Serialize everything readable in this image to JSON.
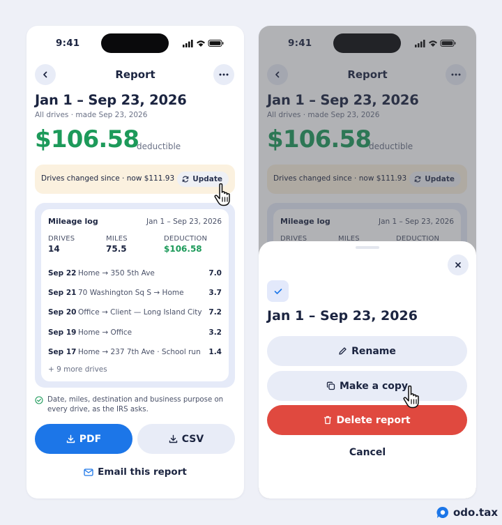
{
  "status": {
    "time": "9:41"
  },
  "screen": {
    "title": "Report",
    "period": "Jan 1 – Sep 23, 2026",
    "subtitle": "All drives · made Sep 23, 2026",
    "amount": "$106.58",
    "amount_suffix": "deductible",
    "banner_text": "Drives changed since · now $111.93",
    "update_label": "Update"
  },
  "log": {
    "title": "Mileage log",
    "date_range": "Jan 1 – Sep 23, 2026",
    "stats": [
      {
        "label": "DRIVES",
        "value": "14"
      },
      {
        "label": "MILES",
        "value": "75.5"
      },
      {
        "label": "DEDUCTION",
        "value": "$106.58"
      }
    ],
    "rows": [
      {
        "date": "Sep 22",
        "route": "Home → 350 5th Ave",
        "miles": "7.0"
      },
      {
        "date": "Sep 21",
        "route": "70 Washington Sq S → Home",
        "miles": "3.7"
      },
      {
        "date": "Sep 20",
        "route": "Office → Client — Long Island City",
        "miles": "7.2"
      },
      {
        "date": "Sep 19",
        "route": "Home → Office",
        "miles": "3.2"
      },
      {
        "date": "Sep 17",
        "route": "Home → 237 7th Ave · School run",
        "miles": "1.4"
      }
    ],
    "more": "+ 9 more drives"
  },
  "note": "Date, miles, destination and business purpose on every drive, as the IRS asks.",
  "actions": {
    "pdf": "PDF",
    "csv": "CSV",
    "email": "Email this report"
  },
  "sheet": {
    "title": "Jan 1 – Sep 23, 2026",
    "rename": "Rename",
    "copy": "Make a copy",
    "delete": "Delete report",
    "cancel": "Cancel"
  },
  "brand": "odo.tax",
  "colors": {
    "green": "#1d9a5a",
    "blue": "#1c76e8",
    "red": "#e0493f",
    "banner": "#fbf1df"
  }
}
